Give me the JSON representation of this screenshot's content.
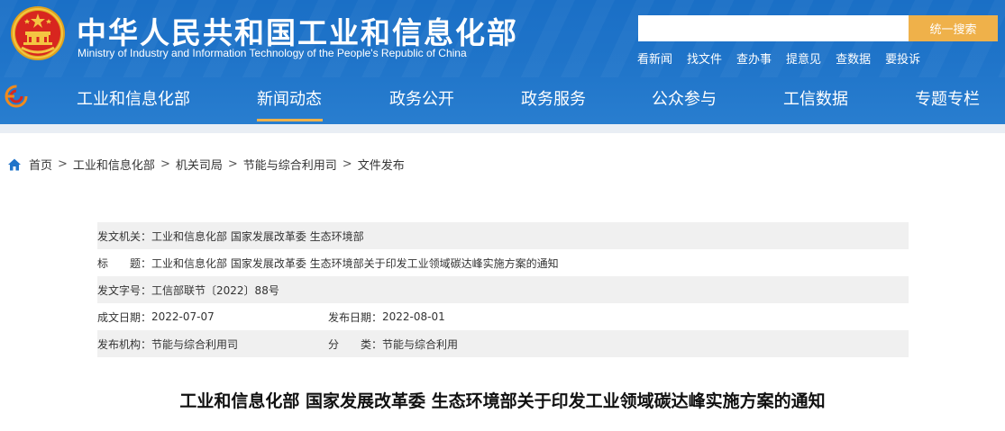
{
  "header": {
    "site_title": "中华人民共和国工业和信息化部",
    "site_subtitle": "Ministry of Industry and Information Technology of the People's Republic of China",
    "search": {
      "placeholder": "",
      "button_label": "统一搜索"
    },
    "quick_links": [
      "看新闻",
      "找文件",
      "查办事",
      "提意见",
      "查数据",
      "要投诉"
    ],
    "colors": {
      "header_blue": "#1f74c9",
      "accent": "#efb14a"
    }
  },
  "nav": {
    "items": [
      "工业和信息化部",
      "新闻动态",
      "政务公开",
      "政务服务",
      "公众参与",
      "工信数据",
      "专题专栏"
    ],
    "active": "新闻动态"
  },
  "breadcrumb": [
    "首页",
    "工业和信息化部",
    "机关司局",
    "节能与综合利用司",
    "文件发布"
  ],
  "doc_info": {
    "issuer_label": "发文机关：",
    "issuer": "工业和信息化部 国家发展改革委 生态环境部",
    "title_label": "标　　题：",
    "title": "工业和信息化部 国家发展改革委 生态环境部关于印发工业领域碳达峰实施方案的通知",
    "doc_no_label": "发文字号：",
    "doc_no": "工信部联节〔2022〕88号",
    "created_label": "成文日期：",
    "created": "2022-07-07",
    "published_label": "发布日期：",
    "published": "2022-08-01",
    "org_label": "发布机构：",
    "org": "节能与综合利用司",
    "category_label": "分　　类：",
    "category": "节能与综合利用"
  },
  "doc_title": "工业和信息化部 国家发展改革委 生态环境部关于印发工业领域碳达峰实施方案的通知"
}
